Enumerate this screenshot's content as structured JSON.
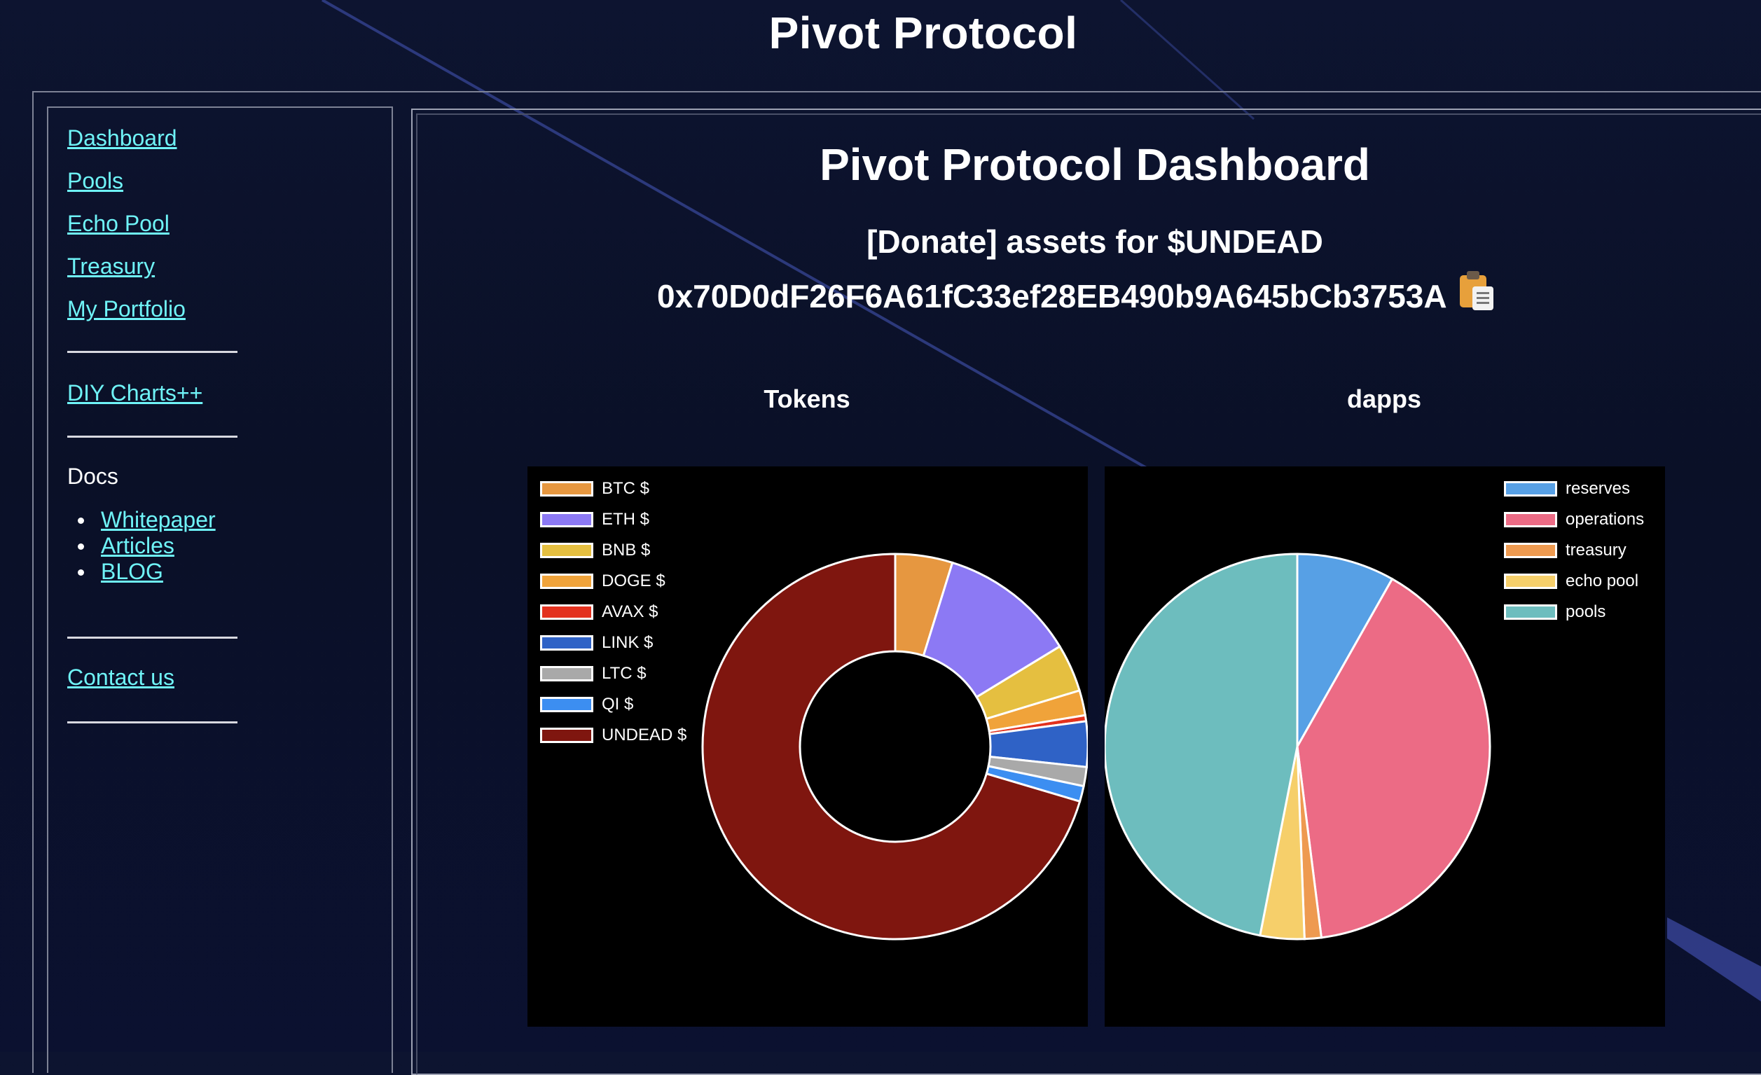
{
  "site": {
    "title": "Pivot Protocol"
  },
  "sidebar": {
    "nav": [
      "Dashboard",
      "Pools",
      "Echo Pool",
      "Treasury",
      "My Portfolio"
    ],
    "diy": "DIY Charts++",
    "docs_label": "Docs",
    "docs": [
      "Whitepaper",
      "Articles",
      "BLOG"
    ],
    "contact": "Contact us"
  },
  "main": {
    "title": "Pivot Protocol Dashboard",
    "donate": "[Donate] assets for $UNDEAD",
    "address": "0x70D0dF26F6A61fC33ef28EB490b9A645bCb3753A"
  },
  "colors": {
    "link": "#6ff3f7",
    "background": "#0b1130"
  },
  "icons": {
    "copy": "clipboard-icon"
  },
  "chart_data": [
    {
      "type": "pie",
      "donut": true,
      "title": "Tokens",
      "legend_position": "top-left",
      "categories": [
        "BTC $",
        "ETH $",
        "BNB $",
        "DOGE $",
        "AVAX $",
        "LINK $",
        "LTC $",
        "QI $",
        "UNDEAD $"
      ],
      "values": [
        4.8,
        11.5,
        4.0,
        2.1,
        0.5,
        3.8,
        1.6,
        1.3,
        70.4
      ],
      "colors": [
        "#e69740",
        "#8c79f4",
        "#e5bf40",
        "#f0a33a",
        "#e3311e",
        "#2f62c6",
        "#a9a9a9",
        "#3c8ef1",
        "#7f160f"
      ]
    },
    {
      "type": "pie",
      "donut": false,
      "title": "dapps",
      "legend_position": "top-right",
      "categories": [
        "reserves",
        "operations",
        "treasury",
        "echo pool",
        "pools"
      ],
      "values": [
        8.2,
        39.8,
        1.4,
        3.7,
        46.9
      ],
      "colors": [
        "#57a0e5",
        "#ec6b85",
        "#ee9a50",
        "#f6cf6a",
        "#6dbdbe"
      ]
    }
  ]
}
